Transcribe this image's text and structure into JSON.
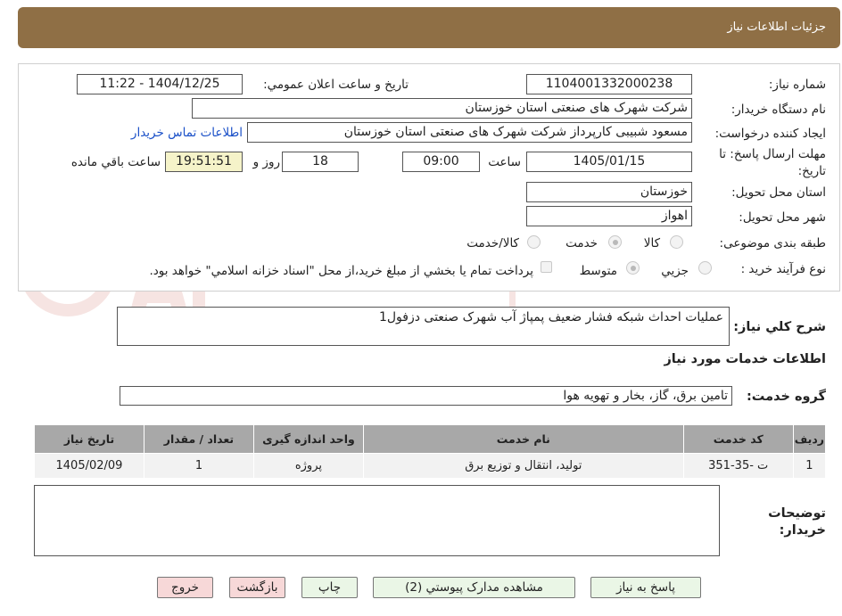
{
  "header": {
    "title": "جزئیات اطلاعات نیاز"
  },
  "form": {
    "need_number_label": "شماره نیاز:",
    "need_number": "1104001332000238",
    "announce_label": "تاریخ و ساعت اعلان عمومي:",
    "announce_value": "1404/12/25 - 11:22",
    "buyer_org_label": "نام دستگاه خريدار:",
    "buyer_org": "شرکت شهرک های صنعتی استان خوزستان",
    "creator_label": "ايجاد کننده درخواست:",
    "creator": "مسعود شبیبی کارپرداز شرکت شهرک های صنعتی استان خوزستان",
    "contact_link": "اطلاعات تماس خريدار",
    "deadline_label": "مهلت ارسال پاسخ: تا تاریخ:",
    "deadline_date": "1405/01/15",
    "time_label": "ساعت",
    "deadline_time": "09:00",
    "days": "18",
    "days_label": "روز و",
    "remaining_time": "19:51:51",
    "remaining_label": "ساعت باقي مانده",
    "province_label": "استان محل تحويل:",
    "province": "خوزستان",
    "city_label": "شهر محل تحويل:",
    "city": "اهواز",
    "category_label": "طبقه بندی موضوعی:",
    "category_options": [
      "کالا",
      "خدمت",
      "کالا/خدمت"
    ],
    "category_selected": "خدمت",
    "process_label": "نوع فرآيند خريد :",
    "process_options": [
      "جزيي",
      "متوسط"
    ],
    "process_selected": "متوسط",
    "payment_note": "پرداخت تمام يا بخشي از مبلغ خريد،از محل \"اسناد خزانه اسلامي\" خواهد بود."
  },
  "description": {
    "label": "شرح کلي نياز:",
    "value": "عملیات احداث شبکه فشار ضعیف پمپاژ آب شهرک صنعتی دزفول1"
  },
  "services": {
    "section_title": "اطلاعات خدمات مورد نياز",
    "group_label": "گروه خدمت:",
    "group_value": "تامين برق، گاز، بخار و تهويه هوا",
    "columns": [
      "رديف",
      "کد خدمت",
      "نام خدمت",
      "واحد اندازه گيری",
      "تعداد / مقدار",
      "تاريخ نياز"
    ],
    "rows": [
      [
        "1",
        "ت -35-351",
        "توليد، انتقال و توزيع برق",
        "پروژه",
        "1",
        "1405/02/09"
      ]
    ]
  },
  "buyer_notes": {
    "label": "توضيحات خريدار:",
    "value": ""
  },
  "buttons": {
    "reply": "پاسخ به نياز",
    "attachments": "مشاهده مدارک پيوستي (2)",
    "print": "چاپ",
    "back": "بازگشت",
    "exit": "خروج"
  },
  "colors": {
    "header_bg": "#8f6f45",
    "table_header_bg": "#a8a8a8",
    "button_bg": "#eaf6e6",
    "danger_button_bg": "#f7d8d8",
    "remaining_bg": "#f5f3c9",
    "link": "#1a50c8"
  }
}
